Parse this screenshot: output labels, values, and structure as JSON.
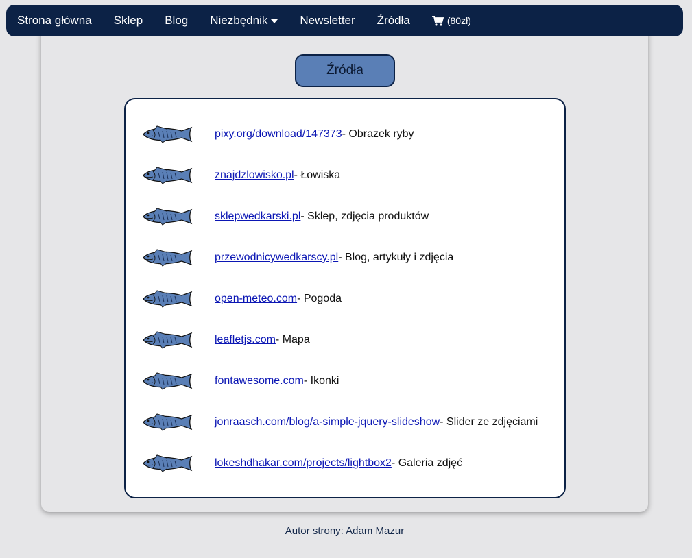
{
  "nav": {
    "items": [
      {
        "label": "Strona główna"
      },
      {
        "label": "Sklep"
      },
      {
        "label": "Blog"
      },
      {
        "label": "Niezbędnik"
      },
      {
        "label": "Newsletter"
      },
      {
        "label": "Źródła"
      }
    ],
    "cart_total": "(80zł)",
    "colors": {
      "background": "#0c2246",
      "text": "#ffffff"
    }
  },
  "page": {
    "title": "Źródła",
    "title_color": "#5a7fb6"
  },
  "sources": [
    {
      "link": "pixy.org/download/147373",
      "desc": "- Obrazek ryby"
    },
    {
      "link": "znajdzlowisko.pl",
      "desc": "- Łowiska"
    },
    {
      "link": "sklepwedkarski.pl",
      "desc": "- Sklep, zdjęcia produktów"
    },
    {
      "link": "przewodnicywedkarscy.pl",
      "desc": "- Blog, artykuły i zdjęcia"
    },
    {
      "link": "open-meteo.com",
      "desc": "- Pogoda"
    },
    {
      "link": "leafletjs.com",
      "desc": "- Mapa"
    },
    {
      "link": "fontawesome.com",
      "desc": "- Ikonki"
    },
    {
      "link": "jonraasch.com/blog/a-simple-jquery-slideshow",
      "desc": "- Slider ze zdjęciami"
    },
    {
      "link": "lokeshdhakar.com/projects/lightbox2",
      "desc": "- Galeria zdjęć"
    }
  ],
  "footer": {
    "text": "Autor strony: Adam Mazur"
  }
}
